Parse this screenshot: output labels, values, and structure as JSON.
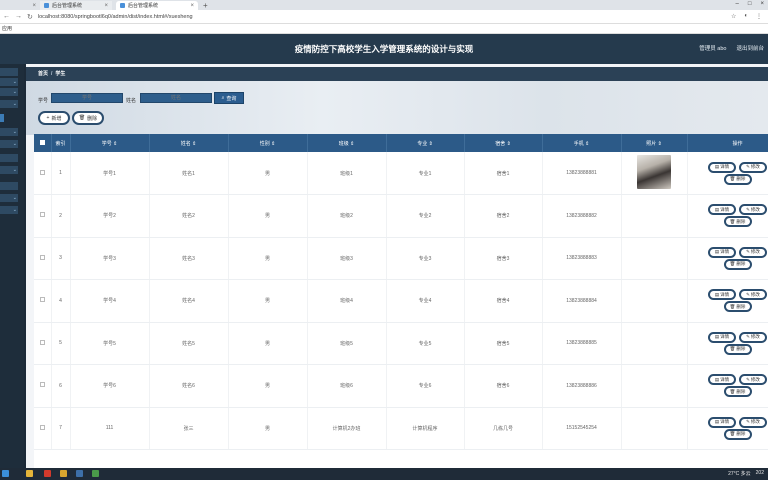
{
  "browser": {
    "tabs": [
      {
        "label": ""
      },
      {
        "label": "后台管理系统"
      },
      {
        "label": "后台管理系统"
      }
    ],
    "url": "localhost:8080/springbootl6q0/admin/dist/index.html#/xuesheng",
    "bookmark": "应用"
  },
  "app": {
    "title": "疫情防控下高校学生入学管理系统的设计与实现",
    "user": "管理员 abo",
    "logout": "退出到前台"
  },
  "breadcrumb": {
    "home": "首页",
    "sep": "/",
    "current": "学生"
  },
  "search": {
    "xuehao_label": "学号",
    "xuehao_placeholder": "学号",
    "xingming_label": "姓名",
    "xingming_placeholder": "姓名",
    "button": "查询"
  },
  "actions": {
    "add": "新增",
    "delete": "删除"
  },
  "table": {
    "headers": [
      "",
      "索引",
      "学号 ⇕",
      "姓名 ⇕",
      "性别 ⇕",
      "班级 ⇕",
      "专业 ⇕",
      "宿舍 ⇕",
      "手机 ⇕",
      "照片 ⇕",
      "操作"
    ],
    "rows": [
      {
        "index": "1",
        "xuehao": "学号1",
        "xingming": "姓名1",
        "xingbie": "男",
        "banji": "班级1",
        "zhuanye": "专业1",
        "sushe": "宿舍1",
        "shouji": "13823888881",
        "has_photo": true
      },
      {
        "index": "2",
        "xuehao": "学号2",
        "xingming": "姓名2",
        "xingbie": "男",
        "banji": "班级2",
        "zhuanye": "专业2",
        "sushe": "宿舍2",
        "shouji": "13823888882",
        "has_photo": false
      },
      {
        "index": "3",
        "xuehao": "学号3",
        "xingming": "姓名3",
        "xingbie": "男",
        "banji": "班级3",
        "zhuanye": "专业3",
        "sushe": "宿舍3",
        "shouji": "13823888883",
        "has_photo": false
      },
      {
        "index": "4",
        "xuehao": "学号4",
        "xingming": "姓名4",
        "xingbie": "男",
        "banji": "班级4",
        "zhuanye": "专业4",
        "sushe": "宿舍4",
        "shouji": "13823888884",
        "has_photo": false
      },
      {
        "index": "5",
        "xuehao": "学号5",
        "xingming": "姓名5",
        "xingbie": "男",
        "banji": "班级5",
        "zhuanye": "专业5",
        "sushe": "宿舍5",
        "shouji": "13823888885",
        "has_photo": false
      },
      {
        "index": "6",
        "xuehao": "学号6",
        "xingming": "姓名6",
        "xingbie": "男",
        "banji": "班级6",
        "zhuanye": "专业6",
        "sushe": "宿舍6",
        "shouji": "13823888886",
        "has_photo": false
      },
      {
        "index": "7",
        "xuehao": "111",
        "xingming": "张三",
        "xingbie": "男",
        "banji": "计算机2办班",
        "zhuanye": "计算机程序",
        "sushe": "几栋几号",
        "shouji": "15152545254",
        "has_photo": false
      }
    ],
    "op_detail": "详情",
    "op_edit": "修改",
    "op_delete": "删除"
  },
  "taskbar": {
    "weather": "27°C 多云",
    "time": "202"
  },
  "colors": {
    "header": "#253a4d",
    "table_header": "#2c5a88",
    "button_border": "#2b4d6e"
  }
}
